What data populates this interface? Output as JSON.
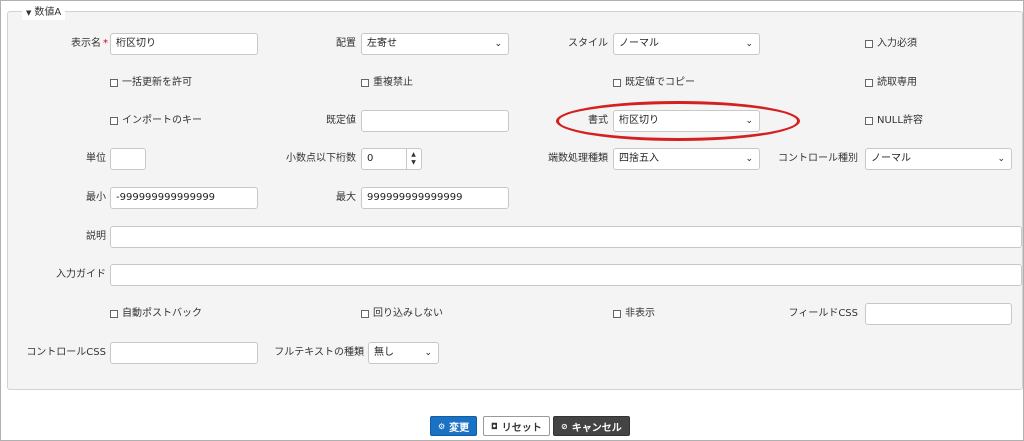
{
  "section": {
    "title": "数値A"
  },
  "row1": {
    "display_name_label": "表示名",
    "required_mark": "*",
    "display_name_value": "桁区切り",
    "layout_label": "配置",
    "layout_value": "左寄せ",
    "style_label": "スタイル",
    "style_value": "ノーマル",
    "required_input_label": "入力必須"
  },
  "row2": {
    "bulk_update_label": "一括更新を許可",
    "no_duplicate_label": "重複禁止",
    "copy_default_label": "既定値でコピー",
    "readonly_label": "読取専用"
  },
  "row3": {
    "import_key_label": "インポートのキー",
    "default_value_label": "既定値",
    "default_value": "",
    "format_label": "書式",
    "format_value": "桁区切り",
    "null_allowed_label": "NULL許容"
  },
  "row4": {
    "unit_label": "単位",
    "unit_value": "",
    "decimal_places_label": "小数点以下桁数",
    "decimal_places_value": "0",
    "rounding_label": "端数処理種類",
    "rounding_value": "四捨五入",
    "control_type_label": "コントロール種別",
    "control_type_value": "ノーマル"
  },
  "row5": {
    "min_label": "最小",
    "min_value": "-999999999999999",
    "max_label": "最大",
    "max_value": "999999999999999"
  },
  "row6": {
    "description_label": "説明",
    "description_value": ""
  },
  "row7": {
    "input_guide_label": "入力ガイド",
    "input_guide_value": ""
  },
  "row8": {
    "auto_postback_label": "自動ポストバック",
    "no_wrap_label": "回り込みしない",
    "hidden_label": "非表示",
    "field_css_label": "フィールドCSS",
    "field_css_value": ""
  },
  "row9": {
    "control_css_label": "コントロールCSS",
    "control_css_value": "",
    "fulltext_type_label": "フルテキストの種類",
    "fulltext_type_value": "無し"
  },
  "buttons": {
    "change_label": "変更",
    "reset_label": "リセット",
    "cancel_label": "キャンセル"
  },
  "colors": {
    "primary": "#1a72c4",
    "dark_button": "#444444",
    "highlight": "#d42020",
    "required": "#d0021b"
  }
}
